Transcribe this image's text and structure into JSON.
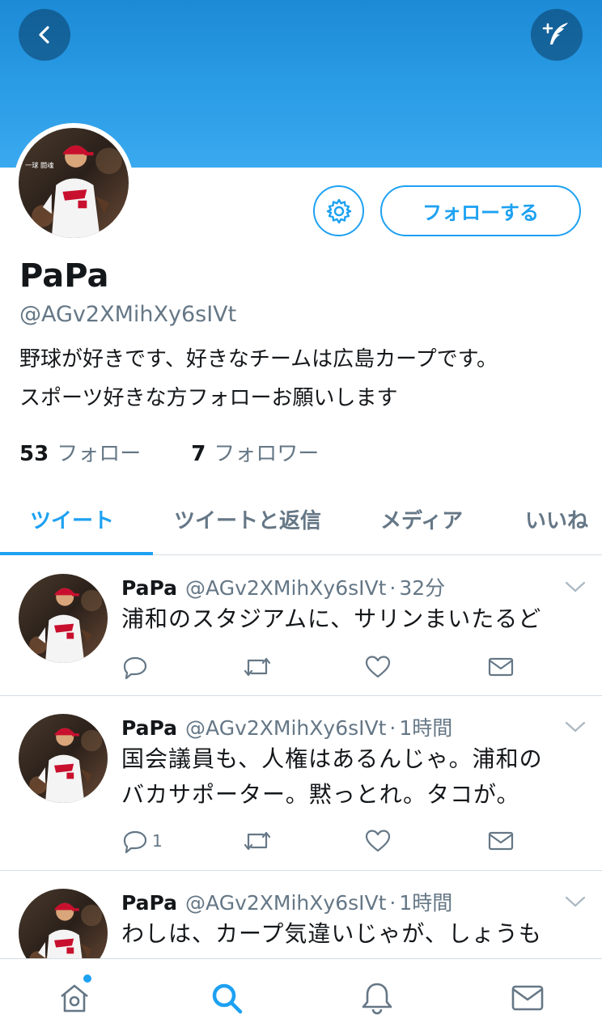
{
  "header": {
    "back_icon": "chevron-left-icon",
    "compose_icon": "compose-feather-icon",
    "banner_color": "#2b9de6"
  },
  "profile": {
    "avatar_overlay_text": "一球 闘魂",
    "display_name": "PaPa",
    "handle": "@AGv2XMihXy6sIVt",
    "bio_line1": "野球が好きです、好きなチームは広島カープです。",
    "bio_line2": "スポーツ好きな方フォローお願いします",
    "settings_icon": "gear-icon",
    "follow_label": "フォローする",
    "following_count": "53",
    "following_label": "フォロー",
    "followers_count": "7",
    "followers_label": "フォロワー"
  },
  "tabs": [
    {
      "label": "ツイート",
      "active": true
    },
    {
      "label": "ツイートと返信",
      "active": false
    },
    {
      "label": "メディア",
      "active": false
    },
    {
      "label": "いいね",
      "active": false
    }
  ],
  "tweets": [
    {
      "name": "PaPa",
      "handle": "@AGv2XMihXy6sIVt",
      "time": "32分",
      "lines": [
        "浦和のスタジアムに、サリンまいたるど"
      ],
      "reply_count": ""
    },
    {
      "name": "PaPa",
      "handle": "@AGv2XMihXy6sIVt",
      "time": "1時間",
      "lines": [
        "国会議員も、人権はあるんじゃ。浦和の",
        "バカサポーター。黙っとれ。タコが。"
      ],
      "reply_count": "1"
    },
    {
      "name": "PaPa",
      "handle": "@AGv2XMihXy6sIVt",
      "time": "1時間",
      "lines": [
        "わしは、カープ気違いじゃが、しょうも"
      ],
      "reply_count": ""
    }
  ],
  "bottom_nav": [
    {
      "icon": "home-icon",
      "active": false,
      "has_dot": true
    },
    {
      "icon": "search-icon",
      "active": true
    },
    {
      "icon": "bell-icon",
      "active": false
    },
    {
      "icon": "mail-icon",
      "active": false
    }
  ],
  "colors": {
    "accent": "#1da1f2",
    "text_primary": "#14171a",
    "text_secondary": "#657786",
    "divider": "#d5dde3"
  }
}
